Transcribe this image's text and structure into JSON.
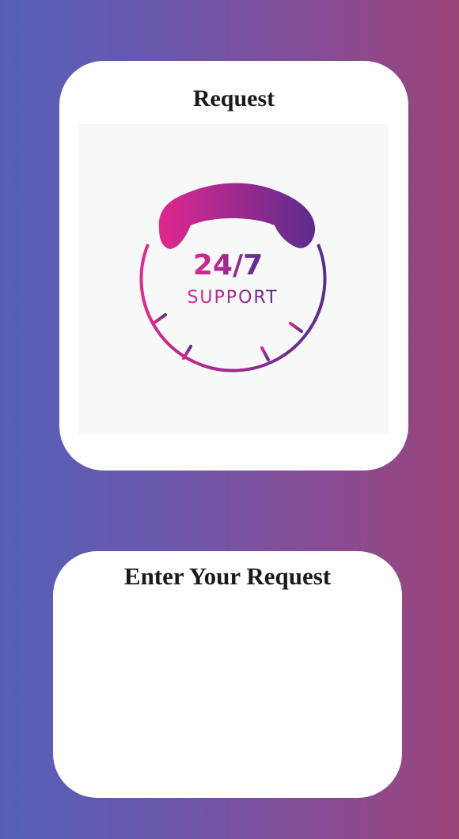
{
  "request_card": {
    "title": "Request",
    "image": {
      "icon": "phone-handset-clock-icon",
      "headline": "24/7",
      "subline": "SUPPORT",
      "gradient_start": "#e0288e",
      "gradient_end": "#5b2c8e"
    }
  },
  "input_card": {
    "title": "Enter Your Request",
    "placeholder": ""
  },
  "colors": {
    "background_start": "#5460b8",
    "background_end": "#9a4478",
    "card": "#ffffff"
  }
}
